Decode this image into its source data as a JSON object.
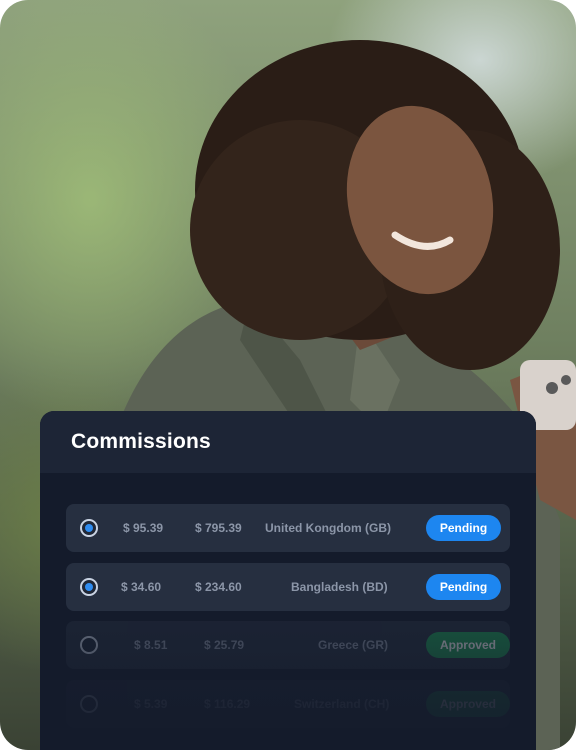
{
  "panel": {
    "title": "Commissions"
  },
  "rows": [
    {
      "selected": true,
      "amount": "$ 95.39",
      "total": "$ 795.39",
      "country": "United Kongdom (GB)",
      "status": "Pending"
    },
    {
      "selected": true,
      "amount": "$ 34.60",
      "total": "$ 234.60",
      "country": "Bangladesh (BD)",
      "status": "Pending"
    },
    {
      "selected": false,
      "amount": "$ 8.51",
      "total": "$ 25.79",
      "country": "Greece (GR)",
      "status": "Approved"
    },
    {
      "selected": false,
      "amount": "$ 5.39",
      "total": "$ 116.29",
      "country": "Switzerland (CH)",
      "status": "Approved"
    }
  ],
  "colors": {
    "panel_bg": "#141b2b",
    "row_bg": "#262f40",
    "pending": "#1d86f0",
    "approved": "#1f9c55",
    "radio_on": "#2f8cf0"
  }
}
